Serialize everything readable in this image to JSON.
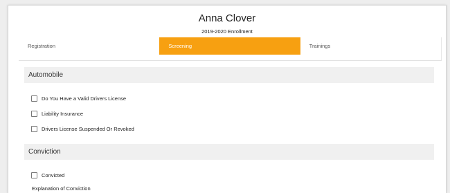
{
  "header": {
    "name": "Anna Clover",
    "enrollment": "2019-2020 Enrollment"
  },
  "tabs": [
    {
      "label": "Registration",
      "active": false
    },
    {
      "label": "Screening",
      "active": true
    },
    {
      "label": "Trainings",
      "active": false
    }
  ],
  "colors": {
    "accent": "#f7a011",
    "section_background": "#f0f0f0"
  },
  "sections": {
    "automobile": {
      "title": "Automobile",
      "items": [
        {
          "label": "Do You Have a Valid Drivers License",
          "checked": false
        },
        {
          "label": "Liability Insurance",
          "checked": false
        },
        {
          "label": "Drivers License Suspended Or Revoked",
          "checked": false
        }
      ]
    },
    "conviction": {
      "title": "Conviction",
      "items": [
        {
          "label": "Convicted",
          "checked": false
        }
      ],
      "explanation_label": "Explanation of Conviction"
    }
  }
}
